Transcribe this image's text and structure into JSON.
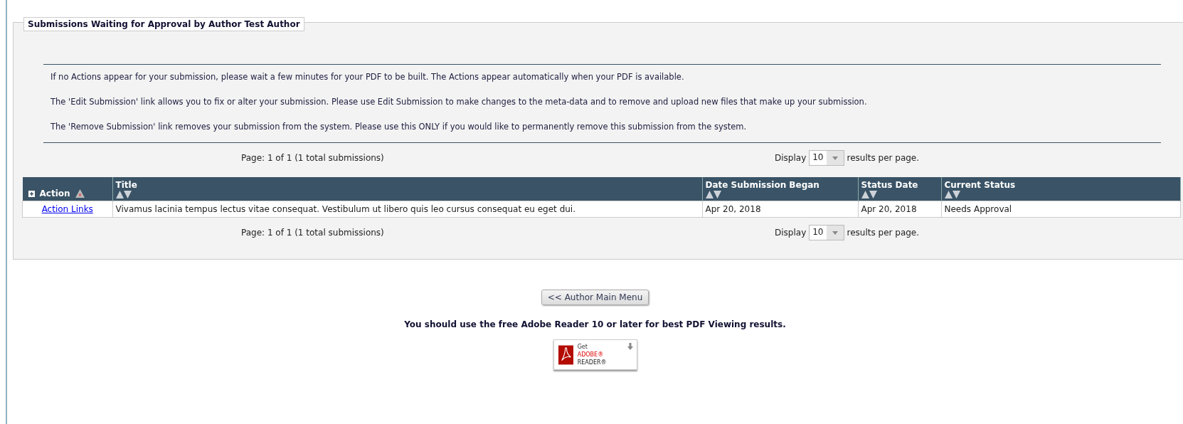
{
  "legend": "Submissions Waiting for Approval by Author Test Author",
  "instructions": [
    "If no Actions appear for your submission, please wait a few minutes for your PDF to be built. The Actions appear automatically when your PDF is available.",
    "The 'Edit Submission' link allows you to fix or alter your submission. Please use Edit Submission to make changes to the meta-data and to remove and upload new files that make up your submission.",
    "The 'Remove Submission' link removes your submission from the system. Please use this ONLY if you would like to permanently remove this submission from the system."
  ],
  "pager_top": {
    "page_info": "Page: 1 of 1 (1 total submissions)",
    "display_label": "Display",
    "per_page": "10",
    "suffix": "results per page."
  },
  "table": {
    "columns": [
      {
        "label": "Action",
        "kind": "action"
      },
      {
        "label": "Title",
        "kind": "sortable"
      },
      {
        "label": "Date Submission Began",
        "kind": "sortable"
      },
      {
        "label": "Status Date",
        "kind": "sortable"
      },
      {
        "label": "Current Status",
        "kind": "sortable"
      }
    ],
    "rows": [
      {
        "action": "Action Links",
        "title": "Vivamus lacinia tempus lectus vitae consequat. Vestibulum ut libero quis leo cursus consequat eu eget dui.",
        "date_began": "Apr 20, 2018",
        "status_date": "Apr 20, 2018",
        "status": "Needs Approval"
      }
    ]
  },
  "pager_bottom": {
    "page_info": "Page: 1 of 1 (1 total submissions)",
    "display_label": "Display",
    "per_page": "10",
    "suffix": "results per page."
  },
  "main_menu_button": "<< Author Main Menu",
  "reader_note": "You should use the free Adobe Reader 10 or later for best PDF Viewing results.",
  "reader_badge": {
    "line_1": "Get",
    "brand": "ADOBE®",
    "product": "READER®"
  }
}
